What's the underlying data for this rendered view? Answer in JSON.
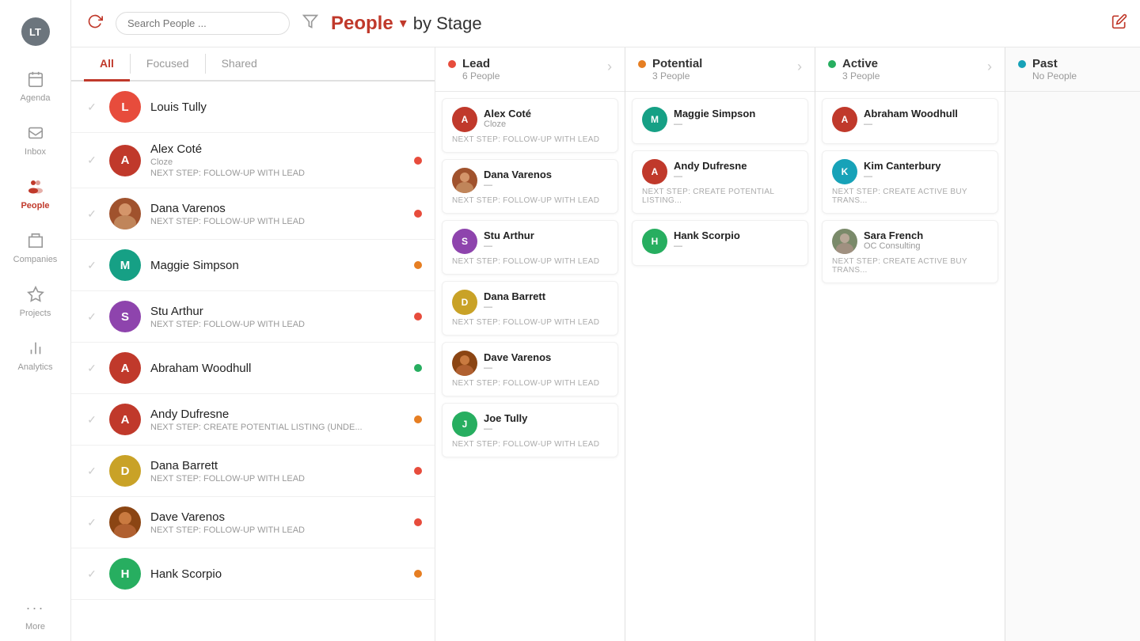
{
  "sidebar": {
    "user_initials": "LT",
    "items": [
      {
        "id": "agenda",
        "label": "Agenda",
        "icon": "calendar-icon"
      },
      {
        "id": "inbox",
        "label": "Inbox",
        "icon": "inbox-icon"
      },
      {
        "id": "people",
        "label": "People",
        "icon": "people-icon",
        "active": true
      },
      {
        "id": "companies",
        "label": "Companies",
        "icon": "companies-icon"
      },
      {
        "id": "projects",
        "label": "Projects",
        "icon": "projects-icon"
      },
      {
        "id": "analytics",
        "label": "Analytics",
        "icon": "analytics-icon"
      },
      {
        "id": "more",
        "label": "More",
        "icon": "more-icon"
      }
    ]
  },
  "topbar": {
    "search_placeholder": "Search People ...",
    "title": "People",
    "subtitle": "by Stage",
    "title_color": "#c0392b"
  },
  "tabs": [
    {
      "id": "all",
      "label": "All",
      "active": true
    },
    {
      "id": "focused",
      "label": "Focused",
      "active": false
    },
    {
      "id": "shared",
      "label": "Shared",
      "active": false
    }
  ],
  "people_list": [
    {
      "id": "louis",
      "name": "Louis Tully",
      "sub": "",
      "avatar_text": "L",
      "avatar_color": "color-red",
      "dot_color": "",
      "has_image": false
    },
    {
      "id": "alex",
      "name": "Alex Coté",
      "sub": "Cloze",
      "sub2": "NEXT STEP: FOLLOW-UP WITH LEAD",
      "avatar_text": "A",
      "avatar_color": "color-darkred",
      "dot_color": "dot-red",
      "has_image": false
    },
    {
      "id": "dana_v",
      "name": "Dana Varenos",
      "sub": "NEXT STEP: FOLLOW-UP WITH LEAD",
      "avatar_text": "",
      "avatar_color": "",
      "dot_color": "dot-red",
      "has_image": true,
      "img_bg": "#a0522d"
    },
    {
      "id": "maggie",
      "name": "Maggie Simpson",
      "sub": "",
      "avatar_text": "M",
      "avatar_color": "color-teal",
      "dot_color": "dot-orange",
      "has_image": false
    },
    {
      "id": "stu",
      "name": "Stu Arthur",
      "sub": "NEXT STEP: FOLLOW-UP WITH LEAD",
      "avatar_text": "S",
      "avatar_color": "color-purple",
      "dot_color": "dot-red",
      "has_image": false
    },
    {
      "id": "abraham",
      "name": "Abraham Woodhull",
      "sub": "",
      "avatar_text": "A",
      "avatar_color": "color-darkred",
      "dot_color": "dot-green",
      "has_image": false
    },
    {
      "id": "andy",
      "name": "Andy Dufresne",
      "sub": "NEXT STEP: CREATE POTENTIAL LISTING (UNDE...",
      "avatar_text": "A",
      "avatar_color": "color-darkred",
      "dot_color": "dot-orange",
      "has_image": false
    },
    {
      "id": "dana_b",
      "name": "Dana Barrett",
      "sub": "NEXT STEP: FOLLOW-UP WITH LEAD",
      "avatar_text": "D",
      "avatar_color": "color-gold",
      "dot_color": "dot-red",
      "has_image": false
    },
    {
      "id": "dave",
      "name": "Dave Varenos",
      "sub": "NEXT STEP: FOLLOW-UP WITH LEAD",
      "avatar_text": "",
      "avatar_color": "",
      "dot_color": "dot-red",
      "has_image": true,
      "img_bg": "#8b4513"
    },
    {
      "id": "hank",
      "name": "Hank Scorpio",
      "sub": "",
      "avatar_text": "H",
      "avatar_color": "color-hank",
      "dot_color": "dot-orange",
      "has_image": false
    }
  ],
  "kanban": {
    "columns": [
      {
        "id": "lead",
        "name": "Lead",
        "count": "6 People",
        "dot_color": "#e74c3c",
        "cards": [
          {
            "name": "Alex Coté",
            "sub": "Cloze",
            "next": "NEXT STEP: FOLLOW-UP WITH LEAD",
            "avatar_text": "A",
            "avatar_color": "color-darkred",
            "has_image": false
          },
          {
            "name": "Dana Varenos",
            "sub": "—",
            "next": "NEXT STEP: FOLLOW-UP WITH LEAD",
            "avatar_text": "",
            "avatar_color": "",
            "has_image": true
          },
          {
            "name": "Stu Arthur",
            "sub": "—",
            "next": "NEXT STEP: FOLLOW-UP WITH LEAD",
            "avatar_text": "S",
            "avatar_color": "color-purple",
            "has_image": false
          },
          {
            "name": "Dana Barrett",
            "sub": "—",
            "next": "NEXT STEP: FOLLOW-UP WITH LEAD",
            "avatar_text": "D",
            "avatar_color": "color-gold",
            "has_image": false
          },
          {
            "name": "Dave Varenos",
            "sub": "—",
            "next": "NEXT STEP: FOLLOW-UP WITH LEAD",
            "avatar_text": "",
            "avatar_color": "",
            "has_image": true
          },
          {
            "name": "Joe Tully",
            "sub": "—",
            "next": "NEXT STEP: FOLLOW-UP WITH LEAD",
            "avatar_text": "J",
            "avatar_color": "color-green",
            "has_image": false
          }
        ]
      },
      {
        "id": "potential",
        "name": "Potential",
        "count": "3 People",
        "dot_color": "#e67e22",
        "cards": [
          {
            "name": "Maggie Simpson",
            "sub": "—",
            "next": "",
            "avatar_text": "M",
            "avatar_color": "color-teal",
            "has_image": false
          },
          {
            "name": "Andy Dufresne",
            "sub": "—",
            "next": "NEXT STEP: CREATE POTENTIAL LISTING...",
            "avatar_text": "A",
            "avatar_color": "color-darkred",
            "has_image": false
          },
          {
            "name": "Hank Scorpio",
            "sub": "—",
            "next": "",
            "avatar_text": "H",
            "avatar_color": "color-hank",
            "has_image": false
          }
        ]
      },
      {
        "id": "active",
        "name": "Active",
        "count": "3 People",
        "dot_color": "#27ae60",
        "cards": [
          {
            "name": "Abraham Woodhull",
            "sub": "—",
            "next": "",
            "avatar_text": "A",
            "avatar_color": "color-darkred",
            "has_image": false
          },
          {
            "name": "Kim Canterbury",
            "sub": "—",
            "next": "NEXT STEP: CREATE ACTIVE BUY TRANS...",
            "avatar_text": "K",
            "avatar_color": "color-cyan",
            "has_image": false
          },
          {
            "name": "Sara French",
            "sub": "OC Consulting",
            "next": "NEXT STEP: CREATE ACTIVE BUY TRANS...",
            "avatar_text": "",
            "avatar_color": "",
            "has_image": true
          }
        ]
      },
      {
        "id": "past",
        "name": "Past",
        "count": "No People",
        "dot_color": "#17a2b8",
        "cards": []
      }
    ]
  }
}
